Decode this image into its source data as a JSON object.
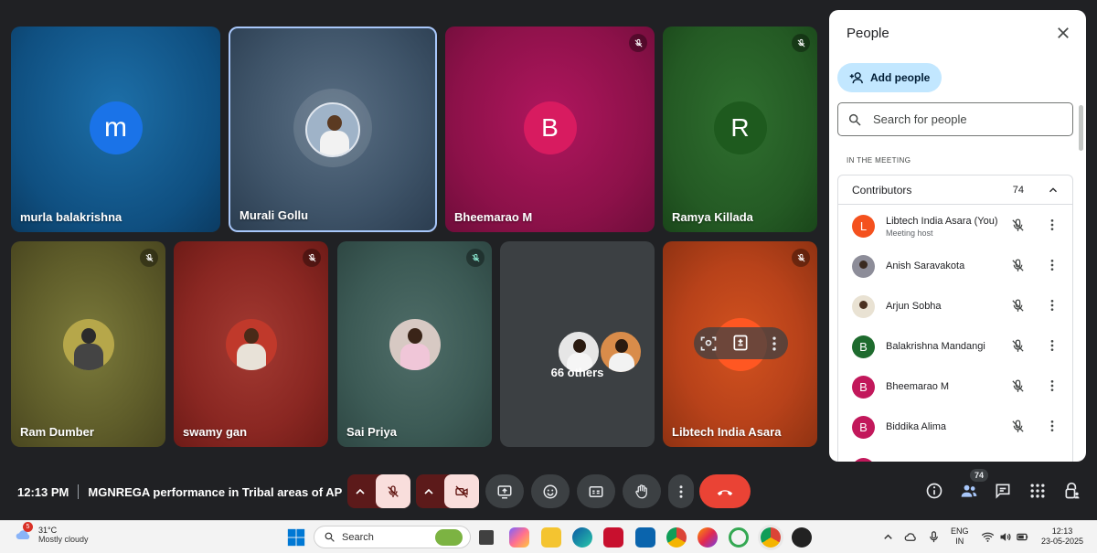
{
  "tiles": [
    {
      "name": "murla balakrishna",
      "avatar": "m",
      "color": "#1a73e8"
    },
    {
      "name": "Murali Gollu"
    },
    {
      "name": "Bheemarao M",
      "avatar": "B",
      "color": "#c2185b"
    },
    {
      "name": "Ramya Killada",
      "avatar": "R",
      "color": "#1e5a1e"
    },
    {
      "name": "Ram Dumber"
    },
    {
      "name": "swamy gan"
    },
    {
      "name": "Sai Priya"
    },
    {
      "name": "66 others"
    },
    {
      "name": "Libtech India Asara"
    }
  ],
  "bottom": {
    "time": "12:13 PM",
    "meeting_title": "MGNREGA performance in Tribal areas of AP",
    "people_count": "74"
  },
  "panel": {
    "title": "People",
    "add_people": "Add people",
    "search_placeholder": "Search for people",
    "section_label": "IN THE MEETING",
    "group_label": "Contributors",
    "group_count": "74",
    "participants": [
      {
        "name": "Libtech India Asara (You)",
        "sub": "Meeting host",
        "avatar": "L",
        "color": "#f4511e"
      },
      {
        "name": "Anish Saravakota",
        "avatar": "",
        "color": "#8d8d99"
      },
      {
        "name": "Arjun Sobha",
        "avatar": "",
        "color": "#e9e2d3"
      },
      {
        "name": "Balakrishna Mandangi",
        "avatar": "B",
        "color": "#1e6b2e"
      },
      {
        "name": "Bheemarao M",
        "avatar": "B",
        "color": "#c2185b"
      },
      {
        "name": "Biddika Alima",
        "avatar": "B",
        "color": "#c2185b"
      }
    ]
  },
  "taskbar": {
    "temperature": "31°C",
    "weather": "Mostly cloudy",
    "weather_badge": "5",
    "search": "Search",
    "lang": "ENG",
    "region": "IN",
    "time": "12:13",
    "date": "23-05-2025"
  }
}
